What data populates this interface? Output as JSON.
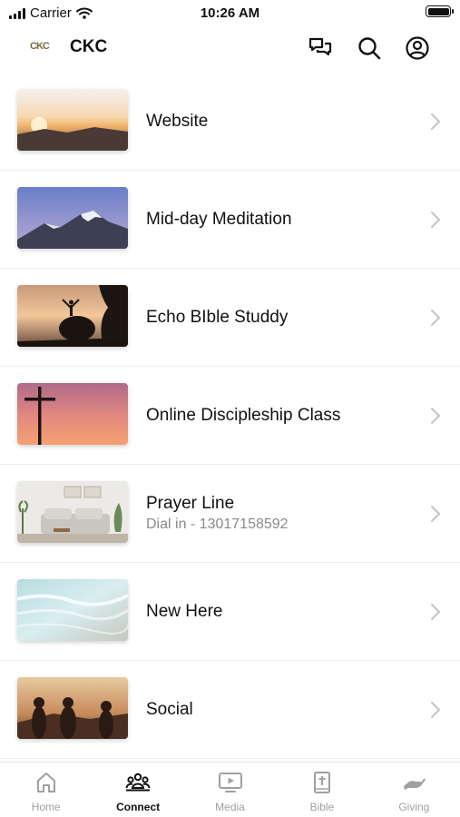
{
  "status_bar": {
    "carrier": "Carrier",
    "time": "10:26 AM"
  },
  "header": {
    "logo_text": "CKC",
    "title": "CKC",
    "icons": [
      "chat-icon",
      "search-icon",
      "account-icon"
    ]
  },
  "list": {
    "items": [
      {
        "title": "Website",
        "subtitle": "",
        "thumbnail": "sunrise-over-mountains"
      },
      {
        "title": "Mid-day Meditation",
        "subtitle": "",
        "thumbnail": "snowy-mountain-peak"
      },
      {
        "title": "Echo BIble Studdy",
        "subtitle": "",
        "thumbnail": "person-on-rock-silhouette"
      },
      {
        "title": "Online Discipleship Class",
        "subtitle": "",
        "thumbnail": "cross-at-sunset"
      },
      {
        "title": "Prayer Line",
        "subtitle": "Dial in - 13017158592",
        "thumbnail": "living-room"
      },
      {
        "title": "New Here",
        "subtitle": "",
        "thumbnail": "ocean-waves"
      },
      {
        "title": "Social",
        "subtitle": "",
        "thumbnail": "people-silhouettes-sunset"
      }
    ]
  },
  "tab_bar": {
    "active": "Connect",
    "tabs": [
      {
        "label": "Home",
        "icon": "home-icon"
      },
      {
        "label": "Connect",
        "icon": "group-icon"
      },
      {
        "label": "Media",
        "icon": "media-play-icon"
      },
      {
        "label": "Bible",
        "icon": "bible-icon"
      },
      {
        "label": "Giving",
        "icon": "giving-hand-icon"
      }
    ]
  },
  "colors": {
    "accent": "#111111",
    "inactive": "#a0a0a0",
    "subtitle": "#8a8a8a",
    "divider": "#ececec"
  }
}
